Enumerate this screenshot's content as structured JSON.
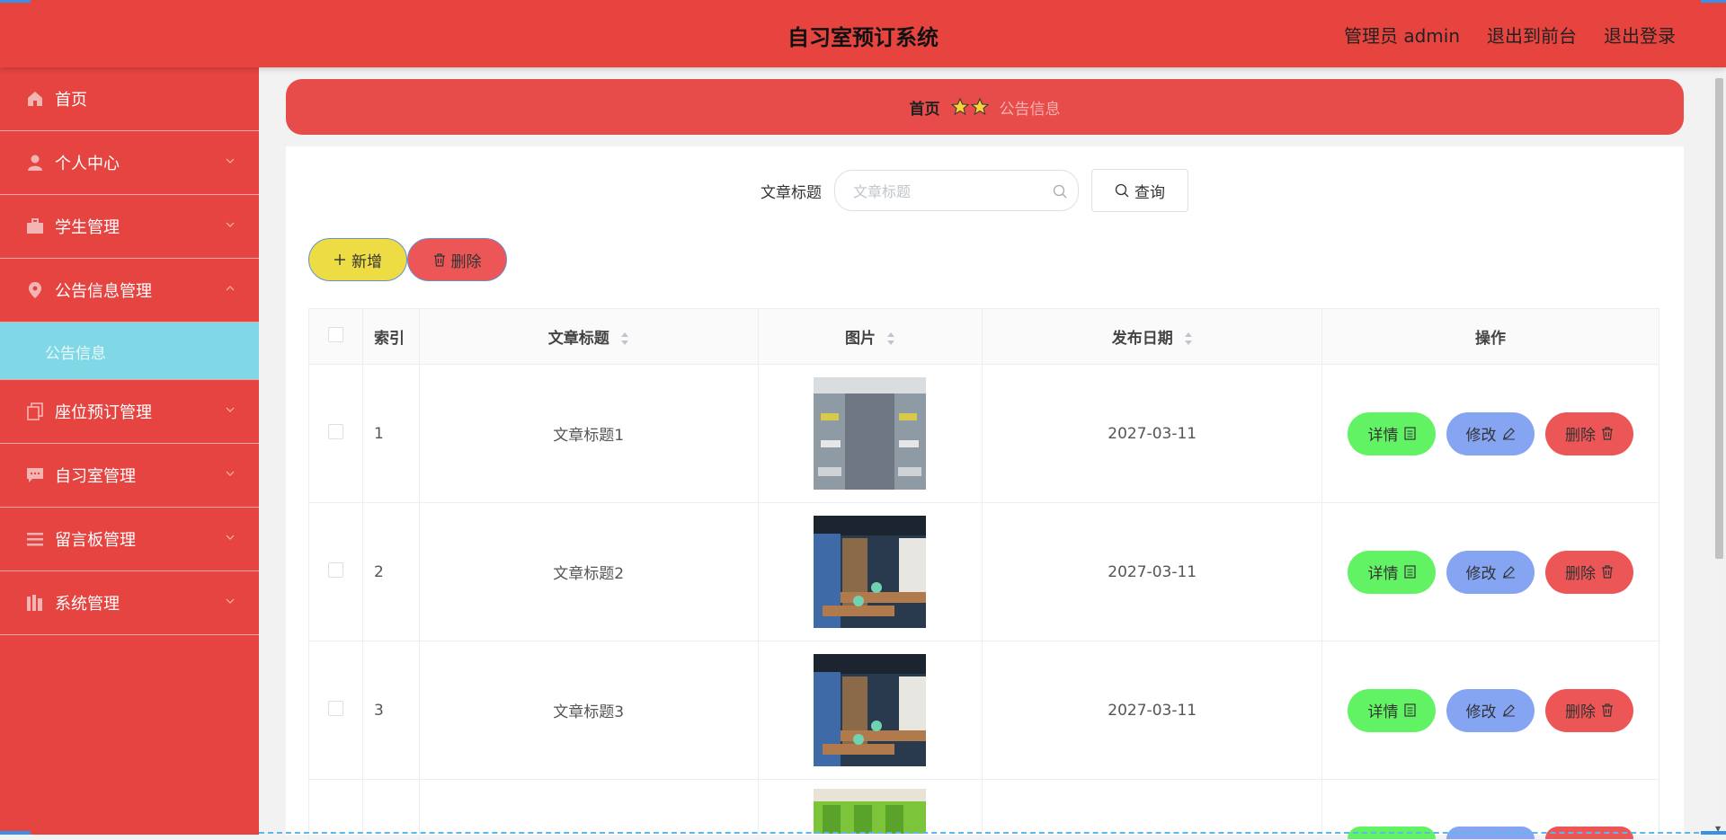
{
  "header": {
    "title": "自习室预订系统",
    "user_label": "管理员 admin",
    "to_front_label": "退出到前台",
    "logout_label": "退出登录"
  },
  "sidebar": {
    "items": [
      {
        "label": "首页",
        "icon": "home-icon"
      },
      {
        "label": "个人中心",
        "icon": "user-icon"
      },
      {
        "label": "学生管理",
        "icon": "briefcase-icon"
      },
      {
        "label": "公告信息管理",
        "icon": "location-pin-icon",
        "expanded": true
      },
      {
        "label": "座位预订管理",
        "icon": "copy-icon"
      },
      {
        "label": "自习室管理",
        "icon": "chat-icon"
      },
      {
        "label": "留言板管理",
        "icon": "list-icon"
      },
      {
        "label": "系统管理",
        "icon": "books-icon"
      }
    ],
    "sub_item": "公告信息"
  },
  "breadcrumb": {
    "home": "首页",
    "current": "公告信息"
  },
  "search": {
    "label": "文章标题",
    "placeholder": "文章标题",
    "button_label": "查询"
  },
  "actions": {
    "add_label": "新增",
    "delete_label": "删除"
  },
  "table": {
    "headers": {
      "index": "索引",
      "title": "文章标题",
      "image": "图片",
      "date": "发布日期",
      "ops": "操作"
    },
    "rows": [
      {
        "index": "1",
        "title": "文章标题1",
        "date": "2027-03-11"
      },
      {
        "index": "2",
        "title": "文章标题2",
        "date": "2027-03-11"
      },
      {
        "index": "3",
        "title": "文章标题3",
        "date": "2027-03-11"
      }
    ],
    "op_labels": {
      "detail": "详情",
      "edit": "修改",
      "remove": "删除"
    }
  },
  "colors": {
    "primary": "#e74440",
    "active_sub": "#80d8e6",
    "detail": "#62f365",
    "edit": "#85a4f2",
    "remove": "#ec5656",
    "add": "#eddc43"
  }
}
